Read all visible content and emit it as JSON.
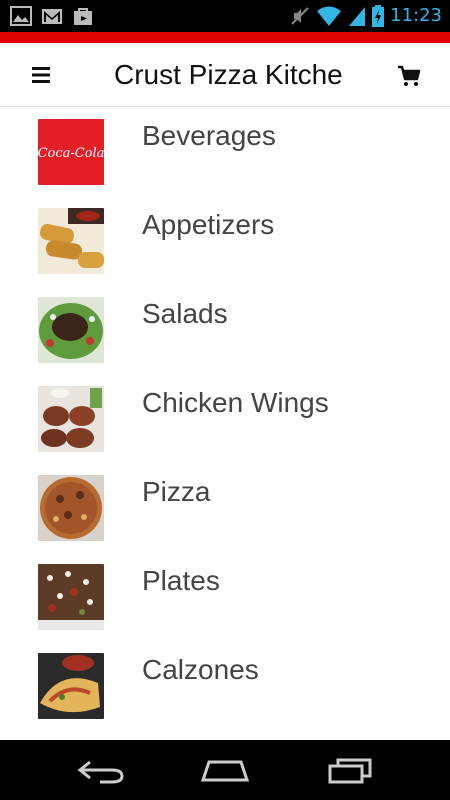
{
  "status_bar": {
    "time": "11:23"
  },
  "app_bar": {
    "title": "Crust Pizza Kitche"
  },
  "colors": {
    "accent_red": "#e00000",
    "status_blue": "#33b5e5"
  },
  "categories": [
    {
      "label": "Beverages",
      "thumbnail_text": "Coca-Cola"
    },
    {
      "label": "Appetizers"
    },
    {
      "label": "Salads"
    },
    {
      "label": "Chicken Wings"
    },
    {
      "label": "Pizza"
    },
    {
      "label": "Plates"
    },
    {
      "label": "Calzones"
    }
  ],
  "icons": {
    "status_left": [
      "image-icon",
      "gmail-icon",
      "shopping-bag-icon"
    ],
    "status_right": [
      "mute-icon",
      "wifi-icon",
      "signal-icon",
      "battery-charging-icon"
    ],
    "app_bar": [
      "menu-icon",
      "cart-icon"
    ],
    "nav": [
      "back-icon",
      "home-icon",
      "recent-apps-icon"
    ]
  }
}
